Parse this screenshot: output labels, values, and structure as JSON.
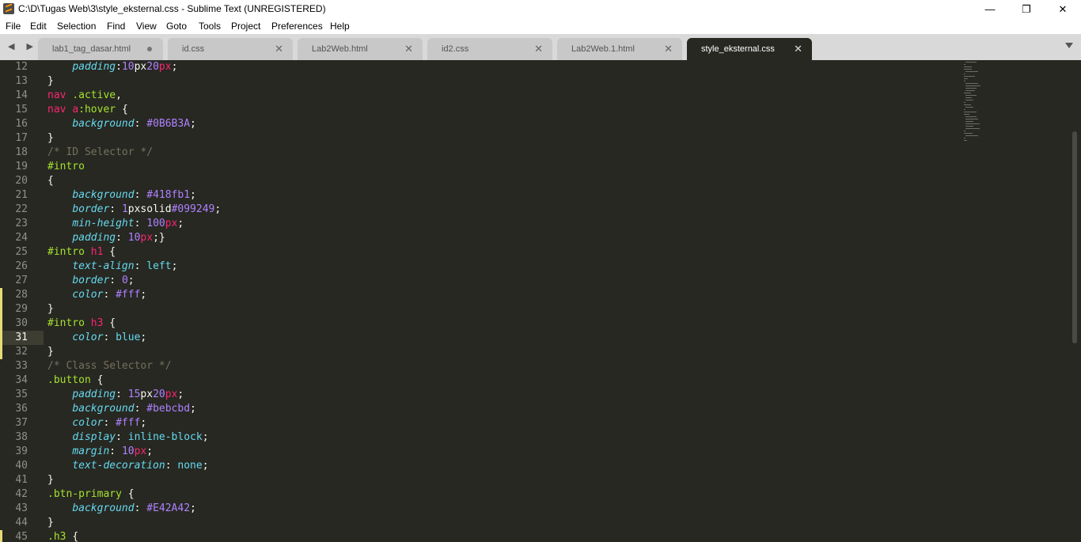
{
  "window": {
    "title": "C:\\D\\Tugas Web\\3\\style_eksternal.css - Sublime Text (UNREGISTERED)",
    "minimize_label": "—",
    "maximize_label": "❐",
    "close_label": "✕"
  },
  "menu": {
    "file": "File",
    "edit": "Edit",
    "selection": "Selection",
    "find": "Find",
    "view": "View",
    "goto": "Goto",
    "tools": "Tools",
    "project": "Project",
    "preferences": "Preferences",
    "help": "Help"
  },
  "tabs": [
    {
      "label": "lab1_tag_dasar.html",
      "dirty": true
    },
    {
      "label": "id.css",
      "close": "✕"
    },
    {
      "label": "Lab2Web.html",
      "close": "✕"
    },
    {
      "label": "id2.css",
      "close": "✕"
    },
    {
      "label": "Lab2Web.1.html",
      "close": "✕"
    },
    {
      "label": "style_eksternal.css",
      "close": "✕",
      "active": true
    }
  ],
  "nav_arrows": "◀ ▶",
  "editor": {
    "current_line": 31,
    "modified_lines": [
      28,
      29,
      30,
      31,
      32,
      45
    ],
    "lines": [
      {
        "n": "12",
        "tokens": [
          [
            "plain",
            "    "
          ],
          [
            "prop",
            "padding"
          ],
          [
            "pun",
            ":"
          ],
          [
            "num",
            "10"
          ],
          [
            "plain",
            "px"
          ],
          [
            "num",
            "20"
          ],
          [
            "unit",
            "px"
          ],
          [
            "pun",
            ";"
          ]
        ]
      },
      {
        "n": "13",
        "tokens": [
          [
            "pun",
            "}"
          ]
        ]
      },
      {
        "n": "14",
        "tokens": [
          [
            "tag",
            "nav"
          ],
          [
            "plain",
            " "
          ],
          [
            "sel",
            ".active"
          ],
          [
            "pun",
            ","
          ]
        ]
      },
      {
        "n": "15",
        "tokens": [
          [
            "tag",
            "nav"
          ],
          [
            "plain",
            " "
          ],
          [
            "tag",
            "a"
          ],
          [
            "sel",
            ":hover"
          ],
          [
            "plain",
            " "
          ],
          [
            "pun",
            "{"
          ]
        ]
      },
      {
        "n": "16",
        "tokens": [
          [
            "plain",
            "    "
          ],
          [
            "prop",
            "background"
          ],
          [
            "pun",
            ": "
          ],
          [
            "num",
            "#0B6B3A"
          ],
          [
            "pun",
            ";"
          ]
        ]
      },
      {
        "n": "17",
        "tokens": [
          [
            "pun",
            "}"
          ]
        ]
      },
      {
        "n": "18",
        "tokens": [
          [
            "com",
            "/* ID Selector */"
          ]
        ]
      },
      {
        "n": "19",
        "tokens": [
          [
            "sel",
            "#intro"
          ]
        ]
      },
      {
        "n": "20",
        "tokens": [
          [
            "pun",
            "{"
          ]
        ]
      },
      {
        "n": "21",
        "tokens": [
          [
            "plain",
            "    "
          ],
          [
            "prop",
            "background"
          ],
          [
            "pun",
            ": "
          ],
          [
            "num",
            "#418fb1"
          ],
          [
            "pun",
            ";"
          ]
        ]
      },
      {
        "n": "22",
        "tokens": [
          [
            "plain",
            "    "
          ],
          [
            "prop",
            "border"
          ],
          [
            "pun",
            ": "
          ],
          [
            "num",
            "1"
          ],
          [
            "plain",
            "pxsolid"
          ],
          [
            "num",
            "#099249"
          ],
          [
            "pun",
            ";"
          ]
        ]
      },
      {
        "n": "23",
        "tokens": [
          [
            "plain",
            "    "
          ],
          [
            "prop",
            "min-height"
          ],
          [
            "pun",
            ": "
          ],
          [
            "num",
            "100"
          ],
          [
            "unit",
            "px"
          ],
          [
            "pun",
            ";"
          ]
        ]
      },
      {
        "n": "24",
        "tokens": [
          [
            "plain",
            "    "
          ],
          [
            "prop",
            "padding"
          ],
          [
            "pun",
            ": "
          ],
          [
            "num",
            "10"
          ],
          [
            "unit",
            "px"
          ],
          [
            "pun",
            ";}"
          ]
        ]
      },
      {
        "n": "25",
        "tokens": [
          [
            "sel",
            "#intro"
          ],
          [
            "plain",
            " "
          ],
          [
            "tag",
            "h1"
          ],
          [
            "plain",
            " "
          ],
          [
            "pun",
            "{"
          ]
        ]
      },
      {
        "n": "26",
        "tokens": [
          [
            "plain",
            "    "
          ],
          [
            "prop",
            "text-align"
          ],
          [
            "pun",
            ": "
          ],
          [
            "kw",
            "left"
          ],
          [
            "pun",
            ";"
          ]
        ]
      },
      {
        "n": "27",
        "tokens": [
          [
            "plain",
            "    "
          ],
          [
            "prop",
            "border"
          ],
          [
            "pun",
            ": "
          ],
          [
            "num",
            "0"
          ],
          [
            "pun",
            ";"
          ]
        ]
      },
      {
        "n": "28",
        "tokens": [
          [
            "plain",
            "    "
          ],
          [
            "prop",
            "color"
          ],
          [
            "pun",
            ": "
          ],
          [
            "num",
            "#fff"
          ],
          [
            "pun",
            ";"
          ]
        ]
      },
      {
        "n": "29",
        "tokens": [
          [
            "pun",
            "}"
          ]
        ]
      },
      {
        "n": "30",
        "tokens": [
          [
            "sel",
            "#intro"
          ],
          [
            "plain",
            " "
          ],
          [
            "tag",
            "h3"
          ],
          [
            "plain",
            " "
          ],
          [
            "pun",
            "{"
          ]
        ]
      },
      {
        "n": "31",
        "tokens": [
          [
            "plain",
            "    "
          ],
          [
            "prop",
            "color"
          ],
          [
            "pun",
            ": "
          ],
          [
            "kw",
            "blue"
          ],
          [
            "pun",
            ";"
          ]
        ]
      },
      {
        "n": "32",
        "tokens": [
          [
            "pun",
            "}"
          ]
        ]
      },
      {
        "n": "33",
        "tokens": [
          [
            "com",
            "/* Class Selector */"
          ]
        ]
      },
      {
        "n": "34",
        "tokens": [
          [
            "sel",
            ".button"
          ],
          [
            "plain",
            " "
          ],
          [
            "pun",
            "{"
          ]
        ]
      },
      {
        "n": "35",
        "tokens": [
          [
            "plain",
            "    "
          ],
          [
            "prop",
            "padding"
          ],
          [
            "pun",
            ": "
          ],
          [
            "num",
            "15"
          ],
          [
            "plain",
            "px"
          ],
          [
            "num",
            "20"
          ],
          [
            "unit",
            "px"
          ],
          [
            "pun",
            ";"
          ]
        ]
      },
      {
        "n": "36",
        "tokens": [
          [
            "plain",
            "    "
          ],
          [
            "prop",
            "background"
          ],
          [
            "pun",
            ": "
          ],
          [
            "num",
            "#bebcbd"
          ],
          [
            "pun",
            ";"
          ]
        ]
      },
      {
        "n": "37",
        "tokens": [
          [
            "plain",
            "    "
          ],
          [
            "prop",
            "color"
          ],
          [
            "pun",
            ": "
          ],
          [
            "num",
            "#fff"
          ],
          [
            "pun",
            ";"
          ]
        ]
      },
      {
        "n": "38",
        "tokens": [
          [
            "plain",
            "    "
          ],
          [
            "prop",
            "display"
          ],
          [
            "pun",
            ": "
          ],
          [
            "kw",
            "inline-block"
          ],
          [
            "pun",
            ";"
          ]
        ]
      },
      {
        "n": "39",
        "tokens": [
          [
            "plain",
            "    "
          ],
          [
            "prop",
            "margin"
          ],
          [
            "pun",
            ": "
          ],
          [
            "num",
            "10"
          ],
          [
            "unit",
            "px"
          ],
          [
            "pun",
            ";"
          ]
        ]
      },
      {
        "n": "40",
        "tokens": [
          [
            "plain",
            "    "
          ],
          [
            "prop",
            "text-decoration"
          ],
          [
            "pun",
            ": "
          ],
          [
            "kw",
            "none"
          ],
          [
            "pun",
            ";"
          ]
        ]
      },
      {
        "n": "41",
        "tokens": [
          [
            "pun",
            "}"
          ]
        ]
      },
      {
        "n": "42",
        "tokens": [
          [
            "sel",
            ".btn-primary"
          ],
          [
            "plain",
            " "
          ],
          [
            "pun",
            "{"
          ]
        ]
      },
      {
        "n": "43",
        "tokens": [
          [
            "plain",
            "    "
          ],
          [
            "prop",
            "background"
          ],
          [
            "pun",
            ": "
          ],
          [
            "num",
            "#E42A42"
          ],
          [
            "pun",
            ";"
          ]
        ]
      },
      {
        "n": "44",
        "tokens": [
          [
            "pun",
            "}"
          ]
        ]
      },
      {
        "n": "45",
        "tokens": [
          [
            "sel",
            ".h3"
          ],
          [
            "plain",
            " "
          ],
          [
            "pun",
            "{"
          ]
        ]
      }
    ]
  },
  "colors": {
    "editor_bg": "#272822",
    "tag": "#f92672",
    "selector": "#a6e22e",
    "property": "#66d9ef",
    "number": "#ae81ff",
    "comment": "#75715e"
  }
}
